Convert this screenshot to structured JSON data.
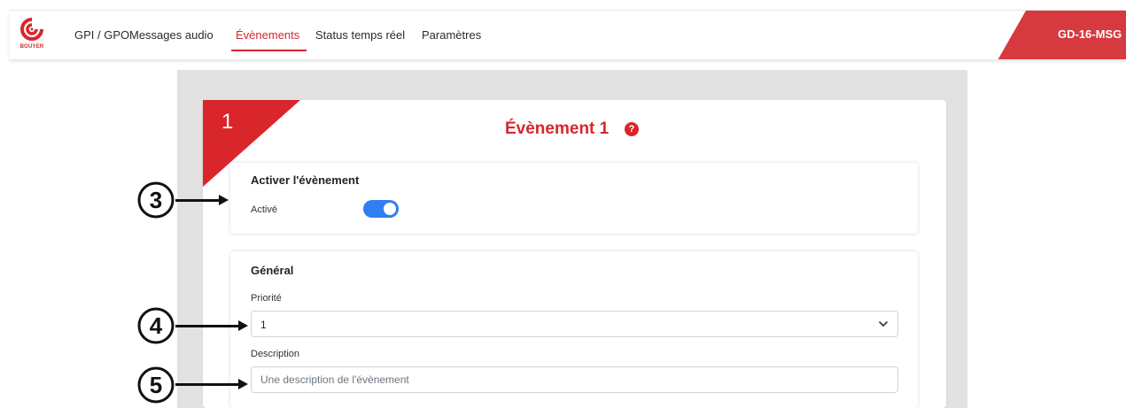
{
  "nav": {
    "brand": "BOUYER",
    "items": [
      {
        "label": "GPI / GPO",
        "active": false
      },
      {
        "label": "Messages audio",
        "active": false
      },
      {
        "label": "Évènements",
        "active": true
      },
      {
        "label": "Status temps réel",
        "active": false
      },
      {
        "label": "Paramètres",
        "active": false
      }
    ],
    "device_name": "GD-16-MSG"
  },
  "event": {
    "number": "1",
    "title": "Évènement 1",
    "help_icon": "?"
  },
  "activer": {
    "title": "Activer l'évènement",
    "toggle_label": "Activé",
    "toggle_on": true
  },
  "general": {
    "title": "Général",
    "priority_label": "Priorité",
    "priority_value": "1",
    "description_label": "Description",
    "description_placeholder": "Une description de l'évènement",
    "description_value": ""
  },
  "callouts": [
    "3",
    "4",
    "5"
  ],
  "colors": {
    "accent": "#d9262b",
    "toggle": "#2f7ff0",
    "panel": "#e2e2e2"
  }
}
